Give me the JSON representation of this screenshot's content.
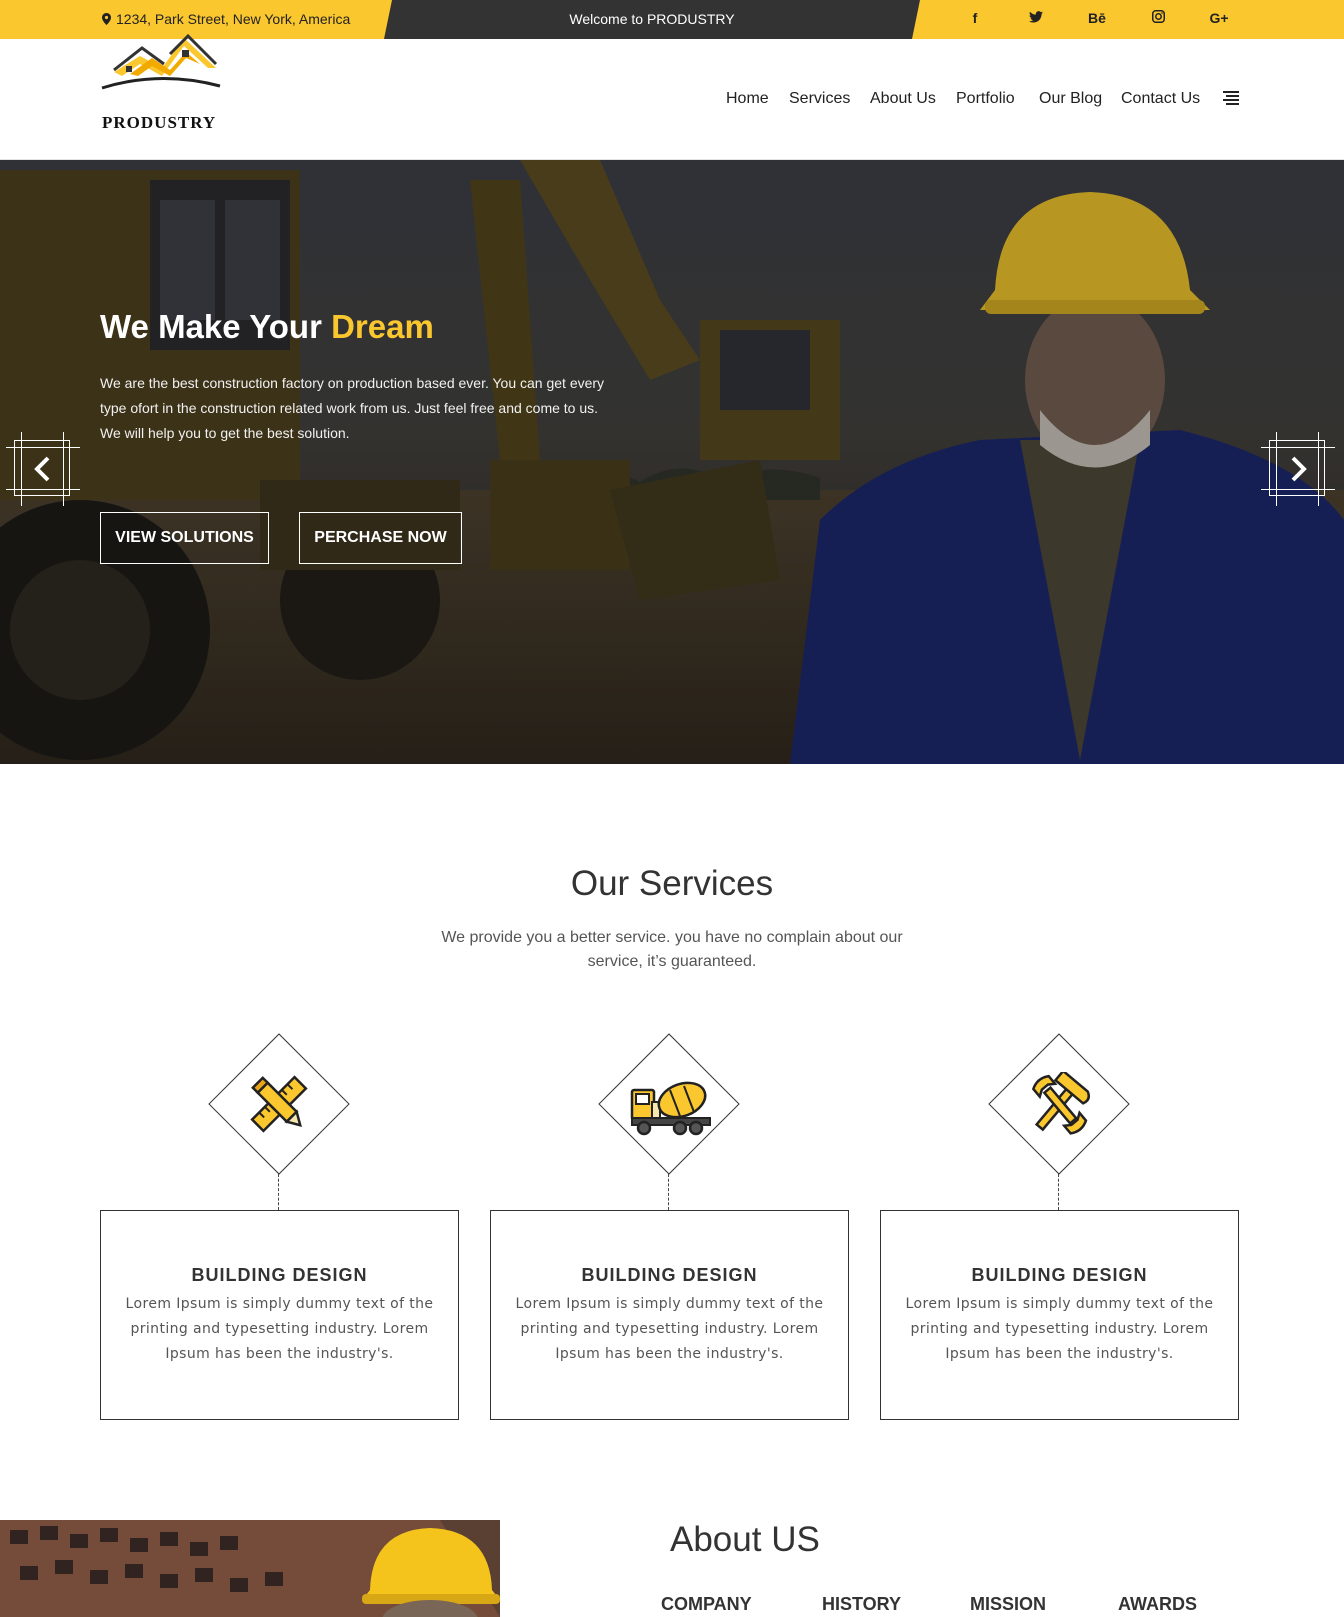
{
  "topbar": {
    "address": "1234, Park Street, New York, America",
    "welcome": "Welcome to PRODUSTRY",
    "social": [
      {
        "label": "f",
        "icon": "facebook-icon"
      },
      {
        "label": "🐦",
        "icon": "twitter-icon"
      },
      {
        "label": "Bē",
        "icon": "behance-icon"
      },
      {
        "label": "◎",
        "icon": "instagram-icon"
      },
      {
        "label": "G+",
        "icon": "google-plus-icon"
      }
    ]
  },
  "brand": {
    "name": "PRODUSTRY"
  },
  "nav": {
    "items": [
      "Home",
      "Services",
      "About Us",
      "Portfolio",
      "Our Blog",
      "Contact Us"
    ],
    "menu_icon": "hamburger-icon"
  },
  "hero": {
    "title_main": "We Make Your",
    "title_accent": "Dream",
    "description": "We are the best construction factory on production based ever. You can get every type ofort in the construction related work from us. Just feel free and come to us. We will help you to get the best solution.",
    "primary_button": "VIEW SOLUTIONS",
    "secondary_button": "PERCHASE NOW",
    "prev_icon": "chevron-left-icon",
    "next_icon": "chevron-right-icon"
  },
  "services": {
    "title": "Our Services",
    "subtitle": "We provide you a better service. you have no complain about our service, it’s guaranteed.",
    "items": [
      {
        "icon": "ruler-pencil-icon",
        "title": "BUILDING DESIGN",
        "text": "Lorem Ipsum is simply dummy text of the printing and typesetting industry. Lorem Ipsum has been the industry's."
      },
      {
        "icon": "mixer-truck-icon",
        "title": "BUILDING DESIGN",
        "text": "Lorem Ipsum is simply dummy text of the printing and typesetting industry. Lorem Ipsum has been the industry's."
      },
      {
        "icon": "hammer-wrench-icon",
        "title": "BUILDING DESIGN",
        "text": "Lorem Ipsum is simply dummy text of the printing and typesetting industry. Lorem Ipsum has been the industry's."
      }
    ]
  },
  "about": {
    "title": "About US",
    "tabs": [
      "COMPANY",
      "HISTORY",
      "MISSION",
      "AWARDS"
    ]
  },
  "colors": {
    "accent": "#fbc72f",
    "dark": "#333333"
  }
}
